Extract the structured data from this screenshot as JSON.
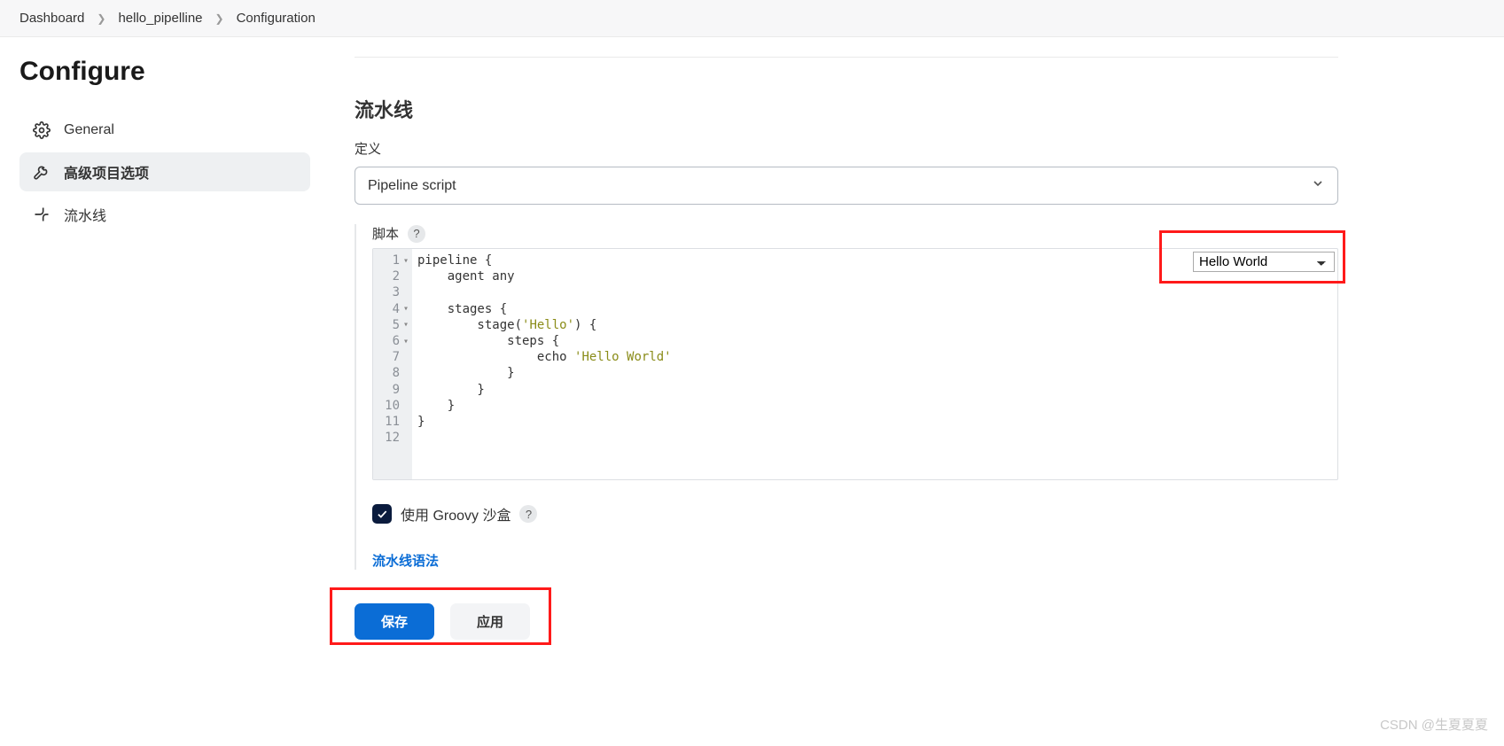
{
  "breadcrumb": {
    "items": [
      "Dashboard",
      "hello_pipelline",
      "Configuration"
    ]
  },
  "page_title": "Configure",
  "sidebar": {
    "items": [
      {
        "label": "General",
        "icon": "gear-icon"
      },
      {
        "label": "高级项目选项",
        "icon": "wrench-icon"
      },
      {
        "label": "流水线",
        "icon": "pipe-icon"
      }
    ]
  },
  "section_title": "流水线",
  "definition_label": "定义",
  "definition_value": "Pipeline script",
  "script_label": "脚本",
  "sample_select": "Hello World",
  "code_lines": [
    {
      "n": 1,
      "fold": true,
      "text": "pipeline {"
    },
    {
      "n": 2,
      "fold": false,
      "text": "    agent any"
    },
    {
      "n": 3,
      "fold": false,
      "text": ""
    },
    {
      "n": 4,
      "fold": true,
      "text": "    stages {"
    },
    {
      "n": 5,
      "fold": true,
      "text": "        stage('Hello') {"
    },
    {
      "n": 6,
      "fold": true,
      "text": "            steps {"
    },
    {
      "n": 7,
      "fold": false,
      "text": "                echo 'Hello World'"
    },
    {
      "n": 8,
      "fold": false,
      "text": "            }"
    },
    {
      "n": 9,
      "fold": false,
      "text": "        }"
    },
    {
      "n": 10,
      "fold": false,
      "text": "    }"
    },
    {
      "n": 11,
      "fold": false,
      "text": "}"
    },
    {
      "n": 12,
      "fold": false,
      "text": ""
    }
  ],
  "sandbox": {
    "checked": true,
    "label": "使用 Groovy 沙盒"
  },
  "syntax_link": "流水线语法",
  "buttons": {
    "save": "保存",
    "apply": "应用"
  },
  "watermark": "CSDN @生夏夏夏"
}
